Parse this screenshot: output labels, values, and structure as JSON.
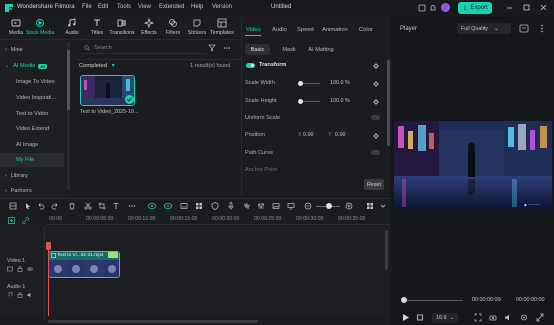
{
  "titlebar": {
    "app_name": "Wondershare Filmora",
    "menus": [
      "File",
      "Edit",
      "Tools",
      "View",
      "Extended",
      "Help",
      "Version"
    ],
    "document_title": "Untitled",
    "export_label": "Export"
  },
  "toolbar": {
    "tools": [
      {
        "label": "Media",
        "icon": "media-icon"
      },
      {
        "label": "Stock Media",
        "icon": "stock-media-icon"
      },
      {
        "label": "Audio",
        "icon": "audio-icon"
      },
      {
        "label": "Titles",
        "icon": "titles-icon"
      },
      {
        "label": "Transitions",
        "icon": "transitions-icon"
      },
      {
        "label": "Effects",
        "icon": "effects-icon"
      },
      {
        "label": "Filters",
        "icon": "filters-icon"
      },
      {
        "label": "Stickers",
        "icon": "stickers-icon"
      },
      {
        "label": "Templates",
        "icon": "templates-icon"
      }
    ],
    "active_tool": "Stock Media"
  },
  "sidebar": {
    "items": [
      {
        "label": "Mine"
      },
      {
        "label": "AI Media",
        "badge": "AI"
      },
      {
        "label": "Image To Video"
      },
      {
        "label": "Video Inspirati..."
      },
      {
        "label": "Text to Video"
      },
      {
        "label": "Video Extend"
      },
      {
        "label": "AI Image"
      },
      {
        "label": "My File"
      },
      {
        "label": "Library"
      },
      {
        "label": "Partners"
      }
    ]
  },
  "media": {
    "search_placeholder": "Search",
    "section_label": "Completed",
    "result_count": "1 result(s) found",
    "thumbnail_label": "Text to Video_2025-10..."
  },
  "properties": {
    "tabs": [
      "Video",
      "Audio",
      "Speed",
      "Animation",
      "Color"
    ],
    "active_tab": "Video",
    "subtabs": [
      "Basic",
      "Mask",
      "AI Matting"
    ],
    "transform_label": "Transform",
    "scale_width_label": "Scale Width",
    "scale_width_value": "100.0",
    "scale_height_label": "Scale Height",
    "scale_height_value": "100.0",
    "percent_unit": "%",
    "uniform_scale_label": "Uniform Scale",
    "position_label": "Position",
    "position_x_axis": "X",
    "position_x": "0.00",
    "position_y_axis": "Y",
    "position_y": "0.00",
    "path_curve_label": "Path Curve",
    "anchor_point_label": "Anchor Point",
    "reset_label": "Reset"
  },
  "player": {
    "title": "Player",
    "quality": "Full Quality",
    "current_time": "00:00:00:00",
    "total_time": "00:00:00:00",
    "aspect_ratio": "16:9",
    "progress": 0
  },
  "timeline": {
    "ruler_labels": [
      "00:00",
      "00:00:05:00",
      "00:00:10:00",
      "00:00:15:00",
      "00:00:20:00",
      "00:00:25:00",
      "00:00:30:00",
      "00:00:35:00"
    ],
    "tracks": [
      {
        "label": "Video 1"
      },
      {
        "label": "Audio 1"
      }
    ],
    "clip_name": "Text to Vi...42-31.mp4"
  },
  "colors": {
    "accent": "#19d1b3",
    "background": "#1b1c1f",
    "playhead": "#e0535a"
  }
}
